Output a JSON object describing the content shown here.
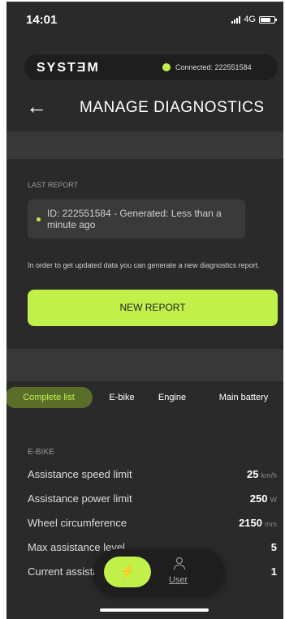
{
  "status_bar": {
    "time": "14:01",
    "network": "4G"
  },
  "header": {
    "brand": "SYSTƎM",
    "connection_text": "Connected: 222551584",
    "title": "MANAGE DIAGNOSTICS"
  },
  "last_report": {
    "label": "LAST REPORT",
    "id_text": "ID: 222551584 - Generated: Less than a minute ago",
    "hint": "In order to get updated data you can generate a new diagnostics report.",
    "button_label": "NEW REPORT"
  },
  "tabs": [
    {
      "label": "Complete list",
      "active": true
    },
    {
      "label": "E-bike",
      "active": false
    },
    {
      "label": "Engine",
      "active": false
    },
    {
      "label": "Main battery",
      "active": false
    }
  ],
  "ebike": {
    "section_label": "E-BIKE",
    "rows": [
      {
        "label": "Assistance speed limit",
        "value": "25",
        "unit": "km/h"
      },
      {
        "label": "Assistance power limit",
        "value": "250",
        "unit": "W"
      },
      {
        "label": "Wheel circumference",
        "value": "2150",
        "unit": "mm"
      },
      {
        "label": "Max assistance level",
        "value": "5",
        "unit": ""
      },
      {
        "label": "Current assistance level",
        "value": "1",
        "unit": ""
      }
    ]
  },
  "bottom_nav": {
    "flash_icon": "⚡",
    "user_label": "User"
  },
  "colors": {
    "accent": "#c2f04a",
    "background": "#2a2a2a",
    "panel": "#3a3a3a"
  },
  "icons": [
    "back-arrow-icon",
    "signal-icon",
    "battery-icon",
    "bluetooth-icon",
    "flash-icon",
    "user-icon"
  ]
}
